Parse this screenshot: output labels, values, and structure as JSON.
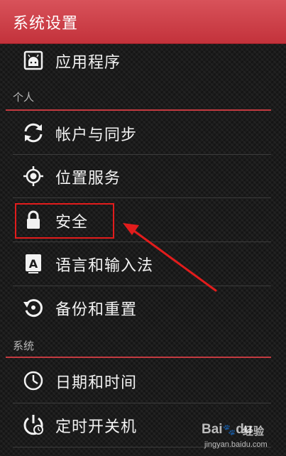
{
  "header": {
    "title": "系统设置"
  },
  "items_top": [
    {
      "label": "应用程序",
      "icon": "apps-icon"
    }
  ],
  "sections": [
    {
      "header": "个人",
      "items": [
        {
          "label": "帐户与同步",
          "icon": "sync-icon"
        },
        {
          "label": "位置服务",
          "icon": "location-icon"
        },
        {
          "label": "安全",
          "icon": "lock-icon"
        },
        {
          "label": "语言和输入法",
          "icon": "keyboard-icon"
        },
        {
          "label": "备份和重置",
          "icon": "backup-restore-icon"
        }
      ]
    },
    {
      "header": "系统",
      "items": [
        {
          "label": "日期和时间",
          "icon": "clock-icon"
        },
        {
          "label": "定时开关机",
          "icon": "power-schedule-icon"
        }
      ]
    }
  ],
  "annotations": {
    "highlight_target": "安全",
    "highlight_color": "#e21c1c"
  },
  "watermark": {
    "brand_text": "Bai",
    "brand_suffix": "du",
    "brand_cn": "经验",
    "url": "jingyan.baidu.com"
  },
  "colors": {
    "accent": "#c9373f",
    "background": "#1b1b1b",
    "text": "#f2f2f2"
  }
}
